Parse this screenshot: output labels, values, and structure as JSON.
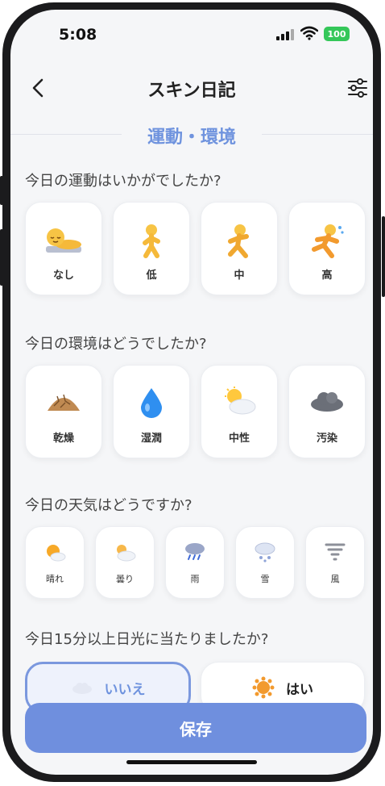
{
  "status": {
    "time": "5:08",
    "battery": "100"
  },
  "nav": {
    "title": "スキン日記"
  },
  "section": {
    "title": "運動・環境"
  },
  "exercise": {
    "question": "今日の運動はいかがでしたか?",
    "options": [
      {
        "label": "なし",
        "icon": "person-resting-icon"
      },
      {
        "label": "低",
        "icon": "person-walking-icon"
      },
      {
        "label": "中",
        "icon": "person-jogging-icon"
      },
      {
        "label": "高",
        "icon": "person-running-icon"
      }
    ]
  },
  "environment": {
    "question": "今日の環境はどうでしたか?",
    "options": [
      {
        "label": "乾燥",
        "icon": "dry-land-icon"
      },
      {
        "label": "湿潤",
        "icon": "water-drop-icon"
      },
      {
        "label": "中性",
        "icon": "sun-behind-cloud-icon"
      },
      {
        "label": "汚染",
        "icon": "dark-cloud-icon"
      }
    ]
  },
  "weather": {
    "question": "今日の天気はどうですか?",
    "options": [
      {
        "label": "晴れ",
        "icon": "sunny-icon"
      },
      {
        "label": "曇り",
        "icon": "cloudy-icon"
      },
      {
        "label": "雨",
        "icon": "rain-icon"
      },
      {
        "label": "雪",
        "icon": "snow-icon"
      },
      {
        "label": "風",
        "icon": "tornado-icon"
      }
    ]
  },
  "sunlight": {
    "question": "今日15分以上日光に当たりましたか?",
    "no_label": "いいえ",
    "yes_label": "はい",
    "selected": "いいえ"
  },
  "save_label": "保存",
  "colors": {
    "accent": "#6f93de",
    "button": "#6f8fde"
  }
}
